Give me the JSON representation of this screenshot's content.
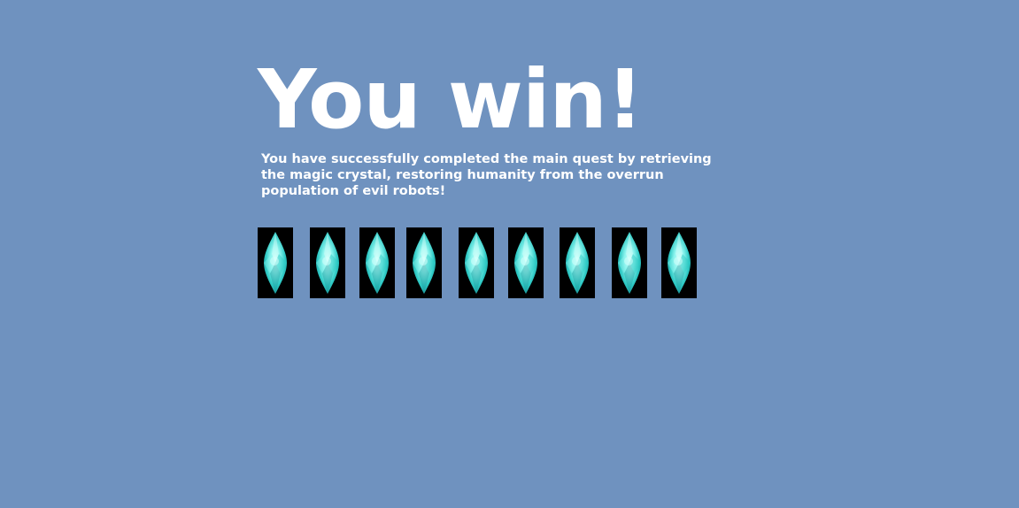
{
  "screen": {
    "background_color": "#6f92bf",
    "text_color": "#ffffff"
  },
  "win_screen": {
    "title": "You win!",
    "message": "You have successfully completed the main quest by retrieving the magic crystal, restoring humanity from the overrun population of evil robots!"
  },
  "crystals": {
    "icon": "magic-crystal-icon",
    "count": 9,
    "colors": {
      "tile": "#000000",
      "gem_dark": "#1a8f95",
      "gem_mid": "#2ec9c4",
      "gem_light": "#8ff5ef",
      "gem_glow": "#d6fffb"
    }
  }
}
